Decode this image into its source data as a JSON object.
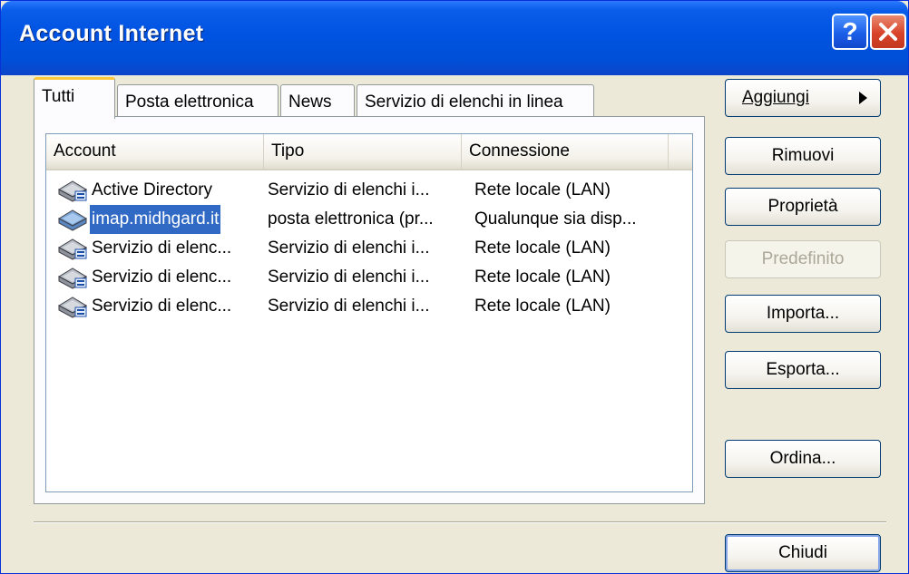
{
  "window": {
    "title": "Account Internet"
  },
  "titlebar": {
    "help_label": "?"
  },
  "tabs": [
    {
      "label": "Tutti",
      "active": true
    },
    {
      "label": "Posta elettronica",
      "active": false
    },
    {
      "label": "News",
      "active": false
    },
    {
      "label": "Servizio di elenchi in linea",
      "active": false
    }
  ],
  "list": {
    "columns": [
      "Account",
      "Tipo",
      "Connessione"
    ],
    "rows": [
      {
        "account": "Active Directory",
        "tipo": "Servizio di elenchi i...",
        "connessione": "Rete locale (LAN)",
        "icon": "directory-service-icon",
        "selected": false
      },
      {
        "account": "imap.midhgard.it",
        "tipo": "posta elettronica (pr...",
        "connessione": "Qualunque sia disp...",
        "icon": "mail-account-icon",
        "selected": true
      },
      {
        "account": "Servizio di elenc...",
        "tipo": "Servizio di elenchi i...",
        "connessione": "Rete locale (LAN)",
        "icon": "directory-service-icon",
        "selected": false
      },
      {
        "account": "Servizio di elenc...",
        "tipo": "Servizio di elenchi i...",
        "connessione": "Rete locale (LAN)",
        "icon": "directory-service-icon",
        "selected": false
      },
      {
        "account": "Servizio di elenc...",
        "tipo": "Servizio di elenchi i...",
        "connessione": "Rete locale (LAN)",
        "icon": "directory-service-icon",
        "selected": false
      }
    ]
  },
  "buttons": {
    "aggiungi": "Aggiungi",
    "rimuovi": "Rimuovi",
    "proprieta": "Proprietà",
    "predefinito": "Predefinito",
    "importa": "Importa...",
    "esporta": "Esporta...",
    "ordina": "Ordina...",
    "chiudi": "Chiudi"
  },
  "colors": {
    "titlebar": "#0053e1",
    "selection": "#316ac5",
    "dialog": "#ece9d8",
    "active_tab_accent": "#ffc83c"
  }
}
